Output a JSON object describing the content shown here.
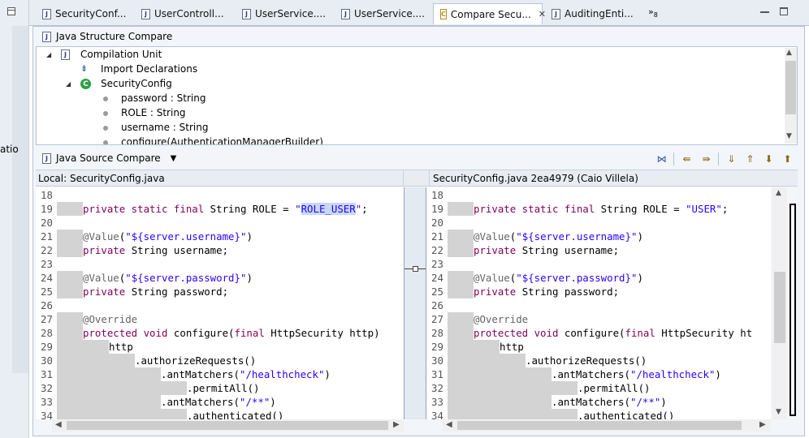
{
  "left_strip": {
    "cut_text": "atio"
  },
  "tabs": [
    {
      "label": "SecurityConf...",
      "icon": "java-file-icon"
    },
    {
      "label": "UserControll...",
      "icon": "java-file-icon"
    },
    {
      "label": "UserService....",
      "icon": "java-file-icon"
    },
    {
      "label": "UserService....",
      "icon": "java-file-icon"
    },
    {
      "label": "Compare Secu...",
      "icon": "compare-icon",
      "active": true
    },
    {
      "label": "AuditingEnti...",
      "icon": "java-file-icon"
    }
  ],
  "tab_overflow": "»",
  "tab_overflow_count": "8",
  "structure": {
    "title": "Java Structure Compare",
    "items": [
      {
        "label": "Compilation Unit",
        "icon": "java-file-icon",
        "twisty": "◢"
      },
      {
        "label": "Import Declarations",
        "icon": "import-icon"
      },
      {
        "label": "SecurityConfig",
        "icon": "class-icon",
        "twisty": "◢"
      },
      {
        "label": "password : String",
        "icon": "field-icon"
      },
      {
        "label": "ROLE : String",
        "icon": "field-icon"
      },
      {
        "label": "username : String",
        "icon": "field-icon"
      },
      {
        "label": "configure(AuthenticationManagerBuilder)",
        "icon": "method-icon"
      }
    ]
  },
  "source": {
    "title": "Java Source Compare",
    "toolbar": [
      "ignore-whitespace-icon",
      "copy-left-icon",
      "copy-right-icon",
      "next-diff-icon",
      "prev-diff-icon",
      "next-change-icon",
      "prev-change-icon"
    ],
    "local_label": "Local: SecurityConfig.java",
    "remote_label": "SecurityConfig.java 2ea4979 (Caio Villela)"
  },
  "left_lines": [
    {
      "n": "18",
      "indent": 0,
      "tokens": []
    },
    {
      "n": "19",
      "indent": 1,
      "tokens": [
        [
          "kw",
          "private static final "
        ],
        [
          "t",
          "String ROLE = "
        ],
        [
          "str",
          "\""
        ],
        [
          "hlstr",
          "ROLE_USER"
        ],
        [
          "str",
          "\""
        ],
        [
          "t",
          ";"
        ]
      ]
    },
    {
      "n": "20",
      "indent": 0,
      "tokens": []
    },
    {
      "n": "21",
      "indent": 1,
      "tokens": [
        [
          "ann",
          "@Value"
        ],
        [
          "t",
          "("
        ],
        [
          "str",
          "\"${server.username}\""
        ],
        [
          "t",
          ")"
        ]
      ]
    },
    {
      "n": "22",
      "indent": 1,
      "tokens": [
        [
          "kw",
          "private "
        ],
        [
          "t",
          "String username;"
        ]
      ]
    },
    {
      "n": "23",
      "indent": 0,
      "tokens": []
    },
    {
      "n": "24",
      "indent": 1,
      "tokens": [
        [
          "ann",
          "@Value"
        ],
        [
          "t",
          "("
        ],
        [
          "str",
          "\"${server.password}\""
        ],
        [
          "t",
          ")"
        ]
      ]
    },
    {
      "n": "25",
      "indent": 1,
      "tokens": [
        [
          "kw",
          "private "
        ],
        [
          "t",
          "String password;"
        ]
      ]
    },
    {
      "n": "26",
      "indent": 0,
      "tokens": []
    },
    {
      "n": "27",
      "indent": 1,
      "tokens": [
        [
          "ann",
          "@Override"
        ]
      ]
    },
    {
      "n": "28",
      "indent": 1,
      "tokens": [
        [
          "kw",
          "protected void "
        ],
        [
          "t",
          "configure("
        ],
        [
          "kw",
          "final "
        ],
        [
          "t",
          "HttpSecurity http)"
        ]
      ]
    },
    {
      "n": "29",
      "indent": 2,
      "tokens": [
        [
          "t",
          "http"
        ]
      ]
    },
    {
      "n": "30",
      "indent": 3,
      "tokens": [
        [
          "t",
          ".authorizeRequests()"
        ]
      ]
    },
    {
      "n": "31",
      "indent": 4,
      "tokens": [
        [
          "t",
          ".antMatchers("
        ],
        [
          "str",
          "\"/healthcheck\""
        ],
        [
          "t",
          ")"
        ]
      ]
    },
    {
      "n": "32",
      "indent": 5,
      "tokens": [
        [
          "t",
          ".permitAll()"
        ]
      ]
    },
    {
      "n": "33",
      "indent": 4,
      "tokens": [
        [
          "t",
          ".antMatchers("
        ],
        [
          "str",
          "\"/**\""
        ],
        [
          "t",
          ")"
        ]
      ]
    },
    {
      "n": "34",
      "indent": 5,
      "tokens": [
        [
          "t",
          ".authenticated()"
        ]
      ]
    }
  ],
  "right_lines": [
    {
      "n": "18",
      "indent": 0,
      "tokens": []
    },
    {
      "n": "19",
      "indent": 1,
      "tokens": [
        [
          "kw",
          "private static final "
        ],
        [
          "t",
          "String ROLE = "
        ],
        [
          "str",
          "\"USER\""
        ],
        [
          "t",
          ";"
        ]
      ]
    },
    {
      "n": "20",
      "indent": 0,
      "tokens": []
    },
    {
      "n": "21",
      "indent": 1,
      "tokens": [
        [
          "ann",
          "@Value"
        ],
        [
          "t",
          "("
        ],
        [
          "str",
          "\"${server.username}\""
        ],
        [
          "t",
          ")"
        ]
      ]
    },
    {
      "n": "22",
      "indent": 1,
      "tokens": [
        [
          "kw",
          "private "
        ],
        [
          "t",
          "String username;"
        ]
      ]
    },
    {
      "n": "23",
      "indent": 0,
      "tokens": []
    },
    {
      "n": "24",
      "indent": 1,
      "tokens": [
        [
          "ann",
          "@Value"
        ],
        [
          "t",
          "("
        ],
        [
          "str",
          "\"${server.password}\""
        ],
        [
          "t",
          ")"
        ]
      ]
    },
    {
      "n": "25",
      "indent": 1,
      "tokens": [
        [
          "kw",
          "private "
        ],
        [
          "t",
          "String password;"
        ]
      ]
    },
    {
      "n": "26",
      "indent": 0,
      "tokens": []
    },
    {
      "n": "27",
      "indent": 1,
      "tokens": [
        [
          "ann",
          "@Override"
        ]
      ]
    },
    {
      "n": "28",
      "indent": 1,
      "tokens": [
        [
          "kw",
          "protected void "
        ],
        [
          "t",
          "configure("
        ],
        [
          "kw",
          "final "
        ],
        [
          "t",
          "HttpSecurity ht"
        ]
      ]
    },
    {
      "n": "29",
      "indent": 2,
      "tokens": [
        [
          "t",
          "http"
        ]
      ]
    },
    {
      "n": "30",
      "indent": 3,
      "tokens": [
        [
          "t",
          ".authorizeRequests()"
        ]
      ]
    },
    {
      "n": "31",
      "indent": 4,
      "tokens": [
        [
          "t",
          ".antMatchers("
        ],
        [
          "str",
          "\"/healthcheck\""
        ],
        [
          "t",
          ")"
        ]
      ]
    },
    {
      "n": "32",
      "indent": 5,
      "tokens": [
        [
          "t",
          ".permitAll()"
        ]
      ]
    },
    {
      "n": "33",
      "indent": 4,
      "tokens": [
        [
          "t",
          ".antMatchers("
        ],
        [
          "str",
          "\"/**\""
        ],
        [
          "t",
          ")"
        ]
      ]
    },
    {
      "n": "34",
      "indent": 5,
      "tokens": [
        [
          "t",
          ".authenticated()"
        ]
      ]
    }
  ]
}
